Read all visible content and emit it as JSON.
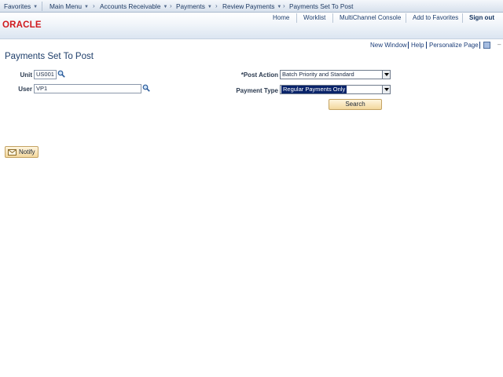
{
  "menubar": {
    "favorites": "Favorites",
    "main_menu": "Main Menu",
    "crumbs": [
      "Accounts Receivable",
      "Payments",
      "Review Payments",
      "Payments Set To Post"
    ]
  },
  "header": {
    "logo": "ORACLE",
    "links": [
      "Home",
      "Worklist",
      "MultiChannel Console",
      "Add to Favorites"
    ],
    "sign_out": "Sign out"
  },
  "pagebar": {
    "new_window": "New Window",
    "help": "Help",
    "personalize": "Personalize Page",
    "dash": "–"
  },
  "page": {
    "title": "Payments Set To Post"
  },
  "form": {
    "unit_label": "Unit",
    "unit_value": "US001",
    "user_label": "User",
    "user_value": "VP1",
    "post_action_label": "*Post Action",
    "post_action_value": "Batch Priority and Standard",
    "payment_type_label": "Payment Type",
    "payment_type_value": "Regular Payments Only",
    "search_label": "Search"
  },
  "actions": {
    "notify_label": "Notify"
  },
  "colors": {
    "brand": "#d0191d",
    "link": "#1c3e79",
    "title": "#1e3e6a",
    "button": "#f3d79c",
    "selection": "#0a246a"
  }
}
